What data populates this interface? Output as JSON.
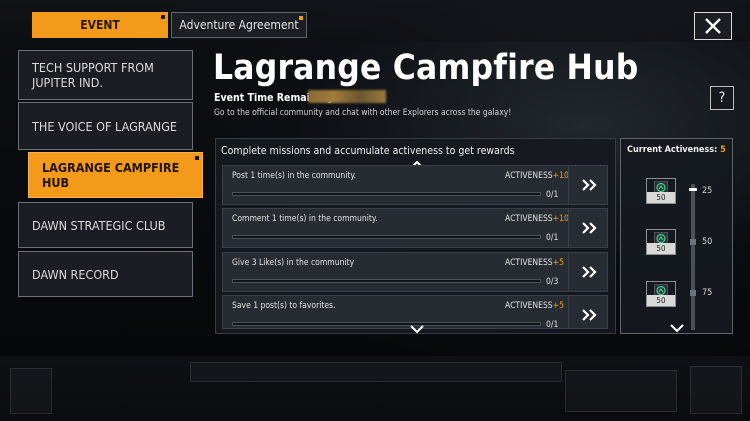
{
  "tabs": {
    "event": "EVENT",
    "adventure": "Adventure Agreement"
  },
  "sidebar": {
    "items": [
      {
        "label": "TECH SUPPORT FROM JUPITER IND.",
        "active": false
      },
      {
        "label": "THE VOICE OF LAGRANGE",
        "active": false
      },
      {
        "label": "LAGRANGE CAMPFIRE HUB",
        "active": true
      },
      {
        "label": "DAWN STRATEGIC CLUB",
        "active": false
      },
      {
        "label": "DAWN RECORD",
        "active": false
      }
    ]
  },
  "header": {
    "title": "Lagrange Campfire Hub",
    "time_label": "Event Time Remaining:",
    "description": "Go to the official community and chat with other Explorers across the galaxy!"
  },
  "missions": {
    "heading": "Complete missions and accumulate activeness to get rewards",
    "items": [
      {
        "text": "Post 1 time(s) in the community.",
        "activeness_label": "ACTIVENESS",
        "activeness_value": "+10",
        "count": "0/1"
      },
      {
        "text": "Comment 1 time(s) in the community.",
        "activeness_label": "ACTIVENESS",
        "activeness_value": "+10",
        "count": "0/1"
      },
      {
        "text": "Give 3 Like(s) in the community",
        "activeness_label": "ACTIVENESS",
        "activeness_value": "+5",
        "count": "0/3"
      },
      {
        "text": "Save 1 post(s) to favorites.",
        "activeness_label": "ACTIVENESS",
        "activeness_value": "+5",
        "count": "0/1"
      }
    ]
  },
  "activeness": {
    "label": "Current Activeness:",
    "value": "5",
    "milestones": [
      {
        "threshold": "25",
        "reward_amount": "50"
      },
      {
        "threshold": "50",
        "reward_amount": "50"
      },
      {
        "threshold": "75",
        "reward_amount": "50"
      }
    ]
  },
  "colors": {
    "accent": "#f39a1b",
    "panel": "#272c32",
    "text": "#e6e6e6"
  }
}
